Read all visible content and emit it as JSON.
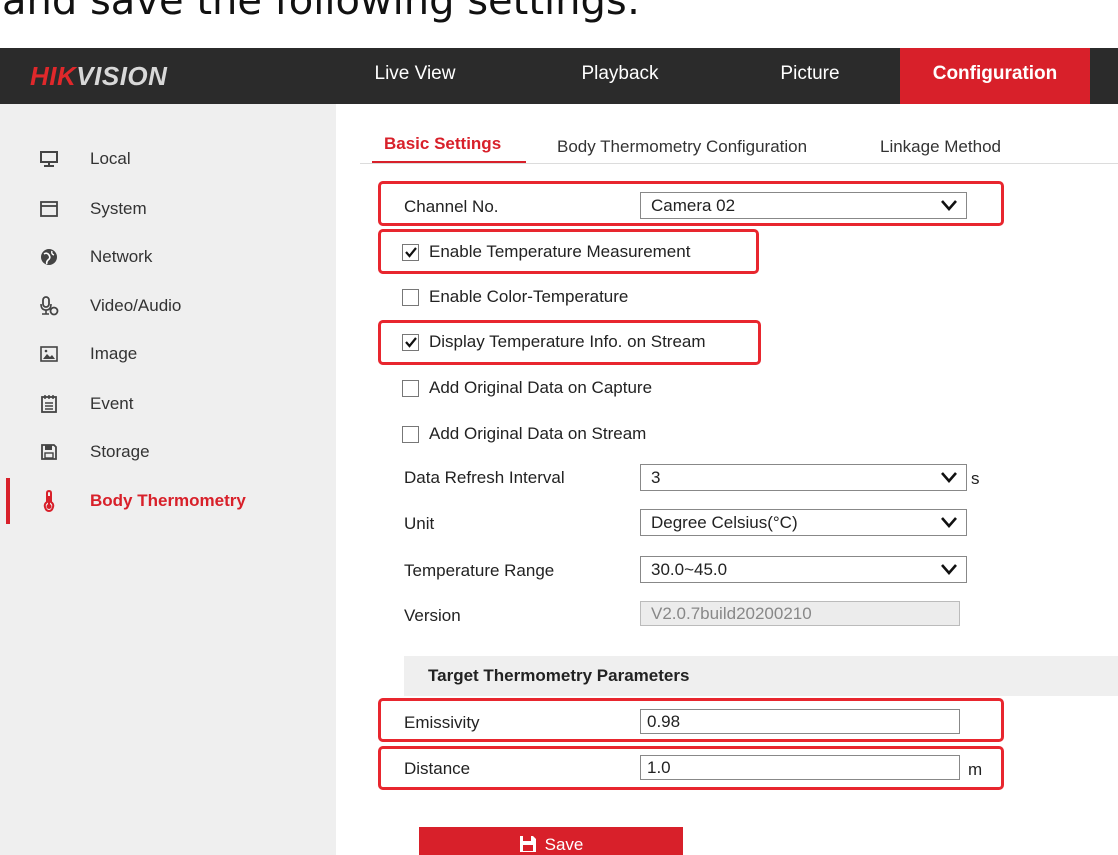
{
  "caption": "and save the following settings:",
  "header": {
    "logo_red": "HIK",
    "logo_white": "VISION",
    "nav": [
      "Live View",
      "Playback",
      "Picture",
      "Configuration"
    ],
    "active_nav": "Configuration"
  },
  "sidebar": {
    "items": [
      {
        "label": "Local",
        "icon": "monitor-icon"
      },
      {
        "label": "System",
        "icon": "system-window-icon"
      },
      {
        "label": "Network",
        "icon": "globe-icon"
      },
      {
        "label": "Video/Audio",
        "icon": "microphone-gear-icon"
      },
      {
        "label": "Image",
        "icon": "image-icon"
      },
      {
        "label": "Event",
        "icon": "calendar-icon"
      },
      {
        "label": "Storage",
        "icon": "floppy-disk-icon"
      },
      {
        "label": "Body Thermometry",
        "icon": "thermometer-icon"
      }
    ],
    "active": "Body Thermometry"
  },
  "tabs": [
    "Basic Settings",
    "Body Thermometry Configuration",
    "Linkage Method"
  ],
  "form": {
    "channel_label": "Channel No.",
    "channel_value": "Camera 02",
    "enable_temp_label": "Enable Temperature Measurement",
    "enable_temp_checked": true,
    "enable_color_label": "Enable Color-Temperature",
    "enable_color_checked": false,
    "display_temp_label": "Display Temperature Info. on Stream",
    "display_temp_checked": true,
    "orig_capture_label": "Add Original Data on Capture",
    "orig_capture_checked": false,
    "orig_stream_label": "Add Original Data on Stream",
    "orig_stream_checked": false,
    "refresh_label": "Data Refresh Interval",
    "refresh_value": "3",
    "refresh_unit": "s",
    "unit_label": "Unit",
    "unit_value": "Degree Celsius(°C)",
    "range_label": "Temperature Range",
    "range_value": "30.0~45.0",
    "version_label": "Version",
    "version_value": "V2.0.7build20200210"
  },
  "target": {
    "title": "Target Thermometry Parameters",
    "emissivity_label": "Emissivity",
    "emissivity_value": "0.98",
    "distance_label": "Distance",
    "distance_value": "1.0",
    "distance_unit": "m"
  },
  "save_label": "Save",
  "colors": {
    "accent": "#d8202a",
    "header_bg": "#2b2b2b",
    "sidebar_bg": "#efefef",
    "highlight": "#e8262e"
  }
}
